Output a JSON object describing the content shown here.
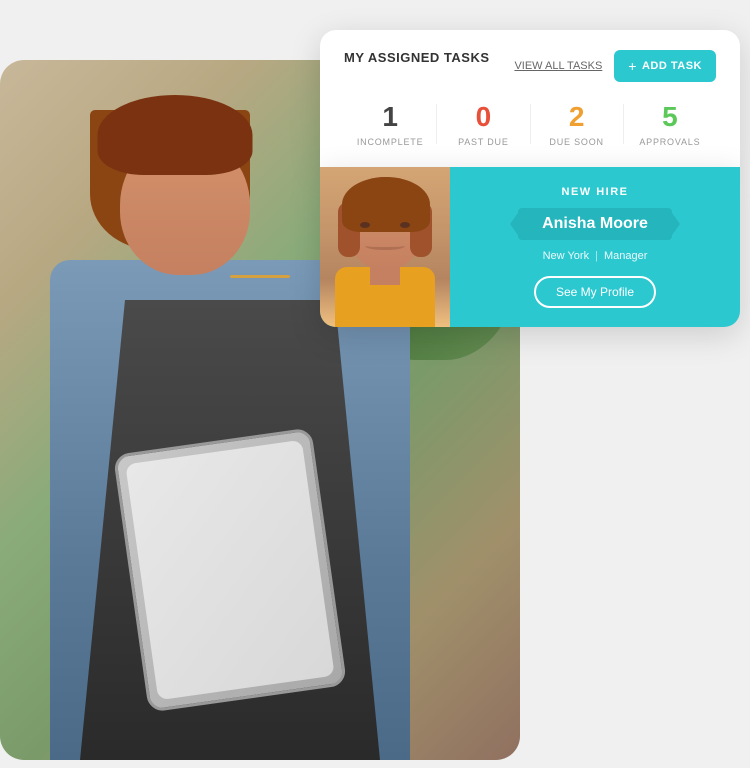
{
  "scene": {
    "background_alt": "Woman in apron using tablet"
  },
  "tasks_card": {
    "title": "MY ASSIGNED\nTASKS",
    "view_all_label": "VIEW ALL TASKS",
    "add_task_label": "ADD TASK",
    "stats": [
      {
        "id": "incomplete",
        "value": "1",
        "label": "INCOMPLETE",
        "color_class": "stat-incomplete"
      },
      {
        "id": "past_due",
        "value": "0",
        "label": "PAST DUE",
        "color_class": "stat-pastdue"
      },
      {
        "id": "due_soon",
        "value": "2",
        "label": "DUE SOON",
        "color_class": "stat-duesoon"
      },
      {
        "id": "approvals",
        "value": "5",
        "label": "APPROVALS",
        "color_class": "stat-approvals"
      }
    ]
  },
  "newhire_card": {
    "label": "NEW HIRE",
    "name": "Anisha Moore",
    "location": "New York",
    "role": "Manager",
    "see_profile_label": "See My Profile"
  },
  "colors": {
    "teal": "#2cc8d0",
    "teal_dark": "#25b5bc",
    "red": "#e8503a",
    "orange": "#f0a030",
    "green": "#5bc85a"
  }
}
